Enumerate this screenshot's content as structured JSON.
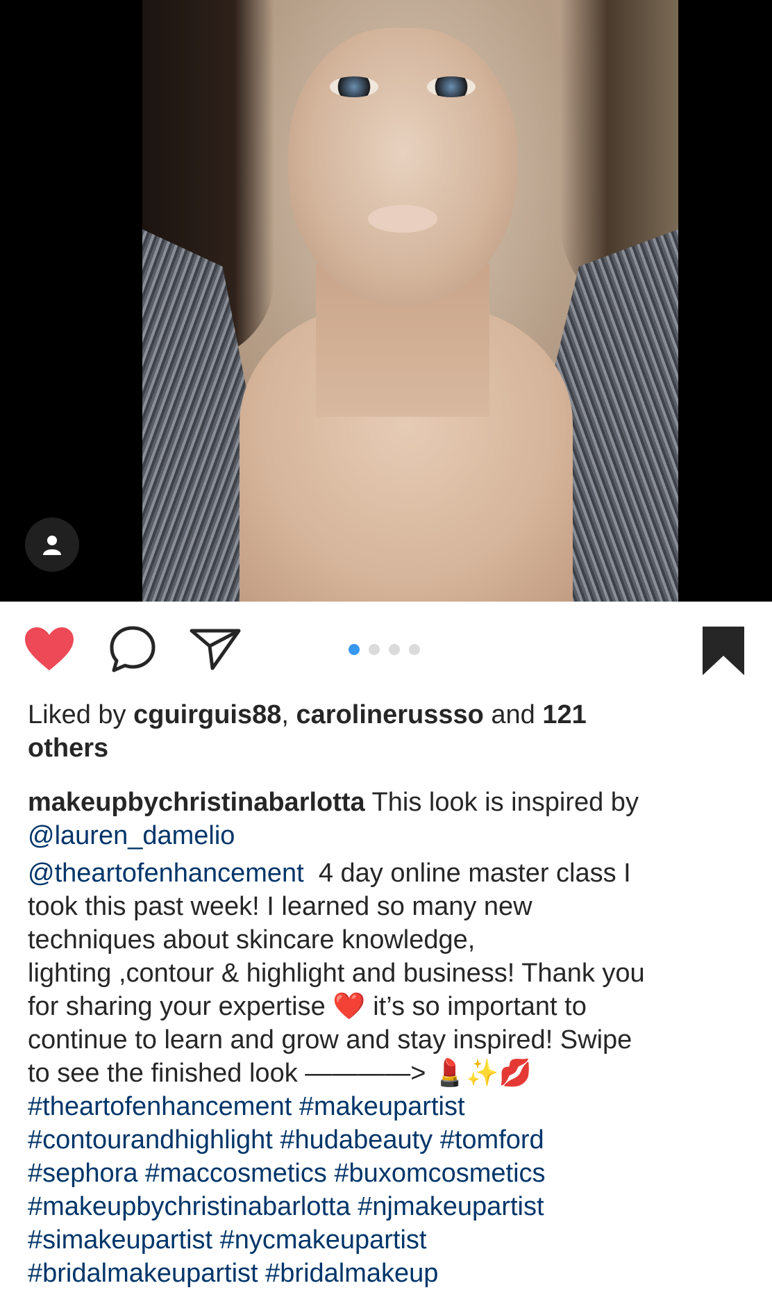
{
  "post": {
    "image_alt_icon": "person-icon",
    "carousel": {
      "count": 4,
      "active_index": 0
    }
  },
  "actions": {
    "like_icon": "heart-icon",
    "comment_icon": "comment-icon",
    "share_icon": "paper-plane-icon",
    "save_icon": "bookmark-icon",
    "like_color": "#ed4956"
  },
  "likes": {
    "prefix": "Liked by ",
    "user1": "cguirguis88",
    "sep": ", ",
    "user2": "carolinerussso",
    "mid": " and ",
    "count": "121",
    "line2": "others"
  },
  "caption": {
    "username": "makeupbychristinabarlotta",
    "intro": " This look is inspired by",
    "mention1": "@lauren_damelio",
    "mention2": "@theartofenhancement",
    "line_a": "  4 day online master class I",
    "line_b": "took this past week! I learned so many new",
    "line_c": "techniques about skincare knowledge,",
    "line_d": "lighting ,contour & highlight and business! Thank you",
    "line_e": "for sharing your expertise ❤️ it’s so important to",
    "line_f": "continue to learn and grow and stay inspired! Swipe",
    "line_g": "to see the finished look ————> 💄✨💋",
    "tags": [
      "#theartofenhancement #makeupartist",
      "#contourandhighlight #hudabeauty #tomford",
      "#sephora #maccosmetics #buxomcosmetics",
      "#makeupbychristinabarlotta #njmakeupartist",
      "#simakeupartist #nycmakeupartist",
      "#bridalmakeupartist #bridalmakeup"
    ]
  }
}
